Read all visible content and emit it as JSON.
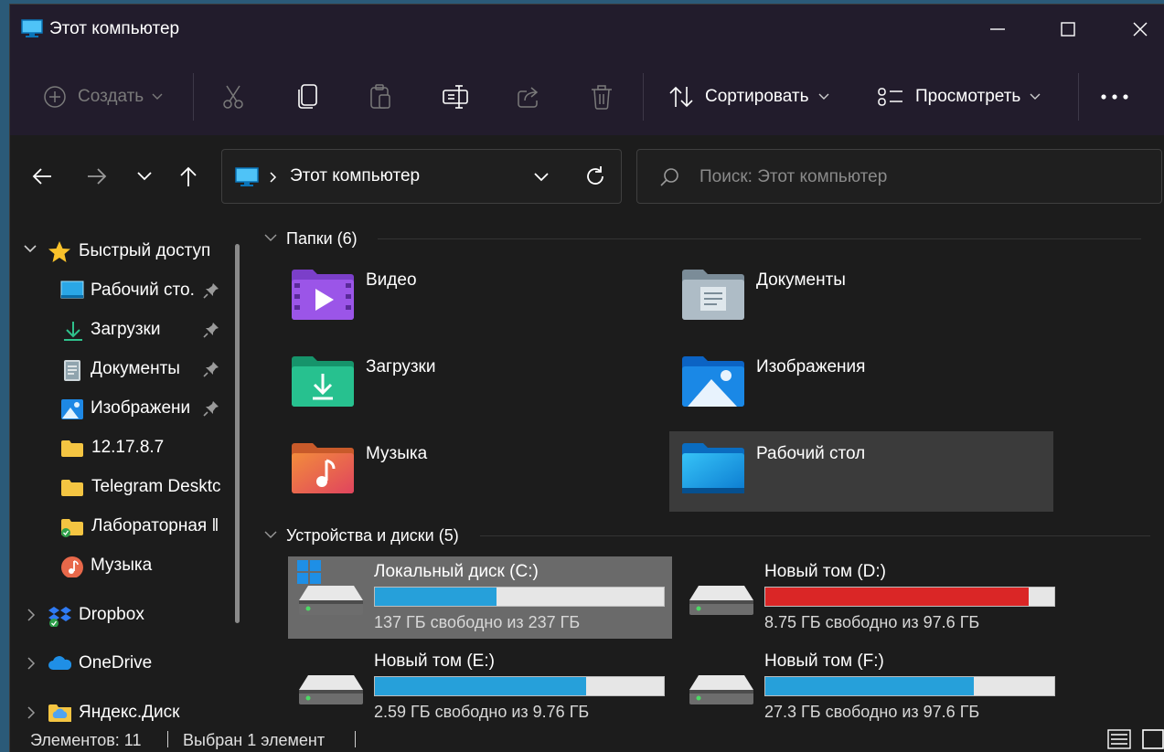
{
  "window": {
    "title": "Этот компьютер"
  },
  "commandbar": {
    "create_label": "Создать",
    "sort_label": "Сортировать",
    "view_label": "Просмотреть",
    "icons": [
      "scissors-icon",
      "copy-icon",
      "paste-icon",
      "rename-icon",
      "share-icon",
      "delete-icon"
    ]
  },
  "address": {
    "path": "Этот компьютер",
    "search_placeholder": "Поиск: Этот компьютер"
  },
  "sidebar": {
    "quick_access": "Быстрый доступ",
    "items": [
      {
        "label": "Рабочий сто.",
        "pinned": true,
        "icon": "desktop-icon"
      },
      {
        "label": "Загрузки",
        "pinned": true,
        "icon": "download-icon"
      },
      {
        "label": "Документы",
        "pinned": true,
        "icon": "document-icon"
      },
      {
        "label": "Изображени",
        "pinned": true,
        "icon": "pictures-icon"
      },
      {
        "label": "12.17.8.7",
        "pinned": false,
        "icon": "folder-icon"
      },
      {
        "label": "Telegram Desktc",
        "pinned": false,
        "icon": "folder-icon"
      },
      {
        "label": "Лабораторная ‖",
        "pinned": false,
        "icon": "folder-icon"
      },
      {
        "label": "Музыка",
        "pinned": false,
        "icon": "music-icon"
      }
    ],
    "roots": [
      {
        "label": "Dropbox",
        "icon": "dropbox-icon"
      },
      {
        "label": "OneDrive",
        "icon": "onedrive-icon"
      },
      {
        "label": "Яндекс.Диск",
        "icon": "yandex-disk-icon"
      }
    ]
  },
  "content": {
    "folders_header": "Папки (6)",
    "folders": [
      {
        "name": "Видео",
        "icon": "videos-folder-icon"
      },
      {
        "name": "Документы",
        "icon": "documents-folder-icon"
      },
      {
        "name": "Загрузки",
        "icon": "downloads-folder-icon"
      },
      {
        "name": "Изображения",
        "icon": "pictures-folder-icon"
      },
      {
        "name": "Музыка",
        "icon": "music-folder-icon"
      },
      {
        "name": "Рабочий стол",
        "icon": "desktop-folder-icon",
        "selected": true
      }
    ],
    "drives_header": "Устройства и диски (5)",
    "drives": [
      {
        "name": "Локальный диск (C:)",
        "free": "137 ГБ свободно из 237 ГБ",
        "used_fraction": 0.42,
        "color": "#26a0da",
        "selected": true,
        "windows": true
      },
      {
        "name": "Новый том (D:)",
        "free": "8.75 ГБ свободно из 97.6 ГБ",
        "used_fraction": 0.91,
        "color": "#da2626",
        "selected": false
      },
      {
        "name": "Новый том (E:)",
        "free": "2.59 ГБ свободно из 9.76 ГБ",
        "used_fraction": 0.73,
        "color": "#26a0da",
        "selected": false
      },
      {
        "name": "Новый том (F:)",
        "free": "27.3 ГБ свободно из 97.6 ГБ",
        "used_fraction": 0.72,
        "color": "#26a0da",
        "selected": false
      }
    ]
  },
  "status": {
    "count": "Элементов: 11",
    "selection": "Выбран 1 элемент"
  }
}
